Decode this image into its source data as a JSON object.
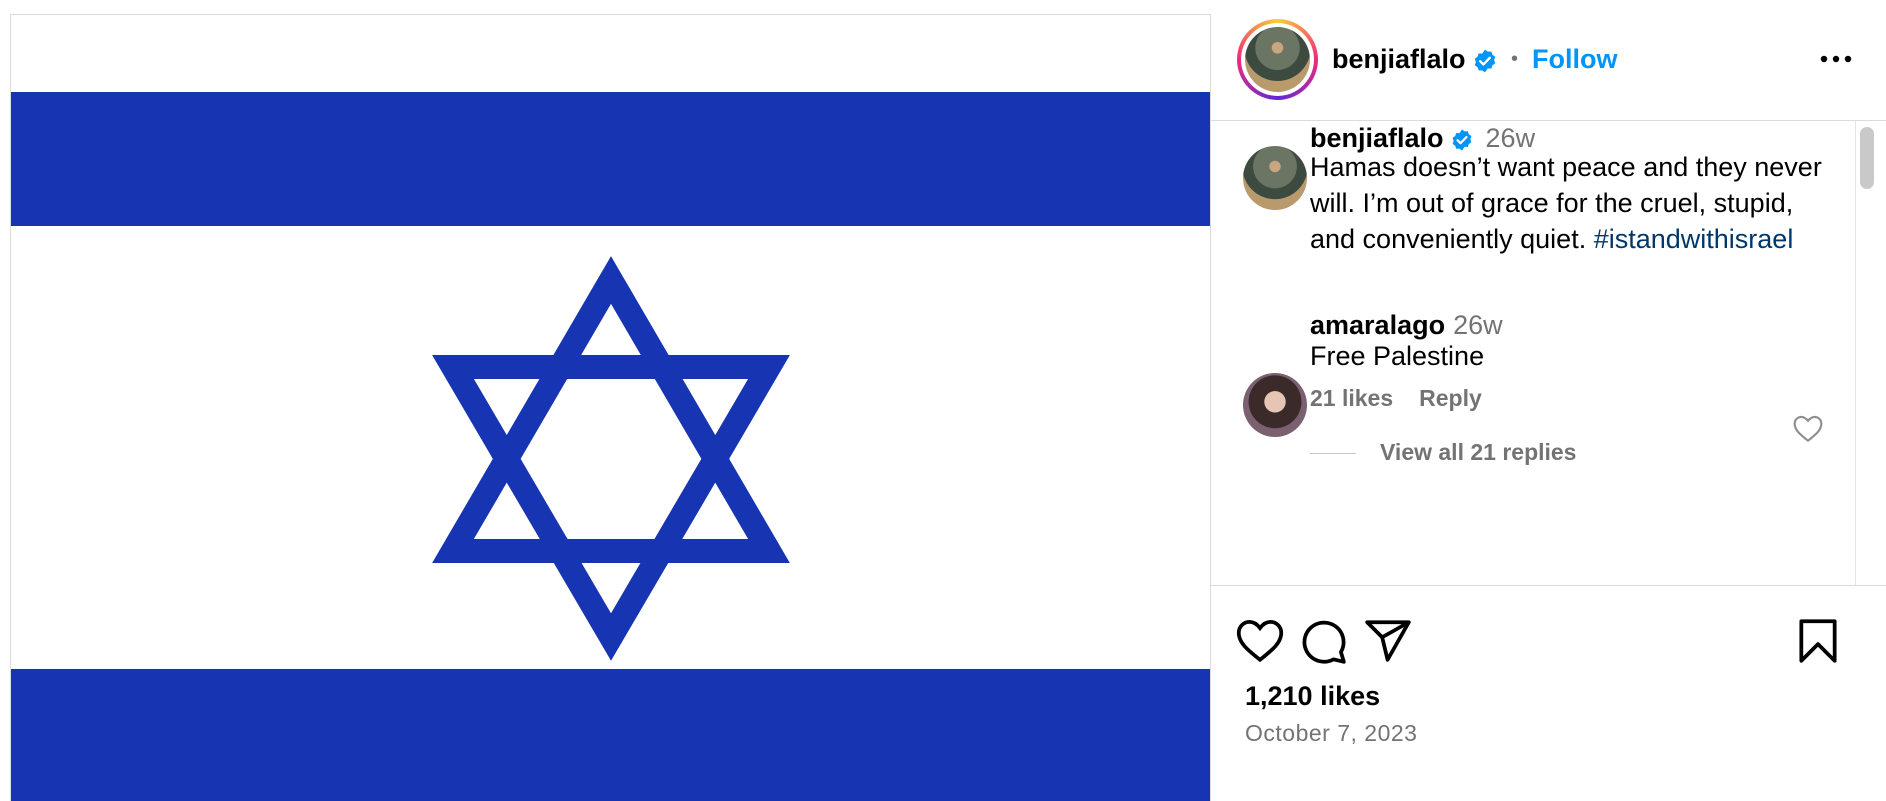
{
  "post": {
    "author": "benjiaflalo",
    "follow_label": "Follow",
    "separator": "•",
    "flag_colors": {
      "blue": "#1734b2",
      "white": "#ffffff"
    }
  },
  "caption": {
    "author": "benjiaflalo",
    "time": "26w",
    "text": "Hamas doesn’t want peace and they never will. I’m out of grace for the cruel, stupid, and conveniently quiet.",
    "hashtag": "#istandwithisrael"
  },
  "comments": [
    {
      "author": "amaralago",
      "time": "26w",
      "text": "Free Palestine",
      "likes": "21 likes",
      "reply_label": "Reply",
      "view_replies": "View all 21 replies"
    }
  ],
  "footer": {
    "likes": "1,210 likes",
    "date": "October 7, 2023"
  },
  "icons": {
    "verified": "verified-badge-icon",
    "more": "more-options-icon",
    "like": "heart-icon",
    "comment": "comment-bubble-icon",
    "share": "paper-plane-icon",
    "save": "bookmark-icon"
  },
  "colors": {
    "link": "#0095f6",
    "hashtag": "#00376b",
    "secondary_text": "#737373",
    "verified": "#0095f6"
  }
}
